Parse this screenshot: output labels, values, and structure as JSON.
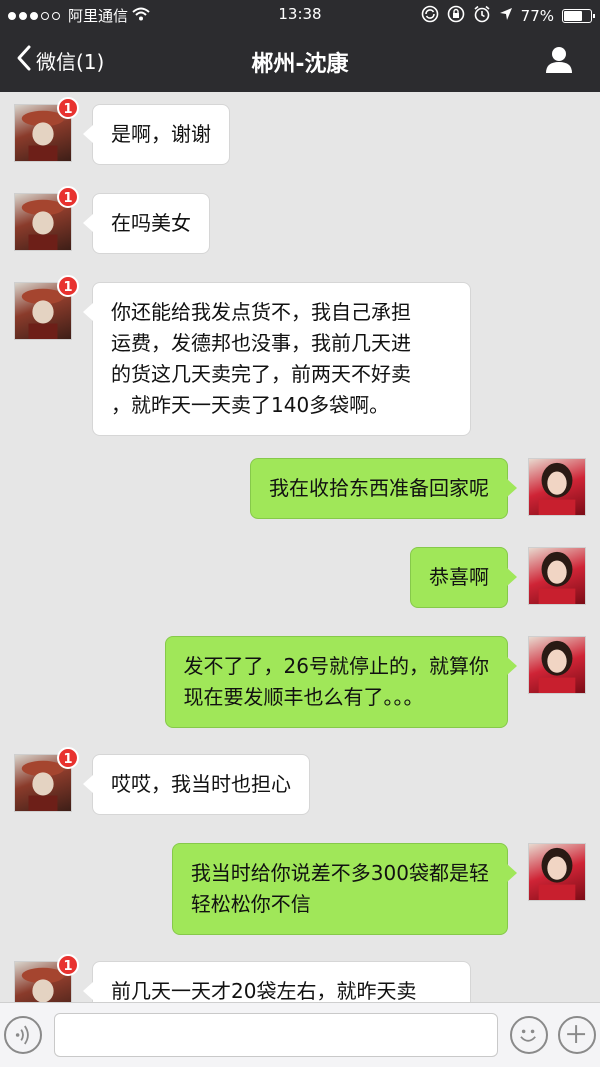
{
  "status_bar": {
    "carrier": "阿里通信",
    "time": "13:38",
    "battery": "77%",
    "battery_level": 0.77,
    "icons": [
      "signal-dots",
      "wifi-icon",
      "sync-icon",
      "orientation-lock-icon",
      "alarm-icon",
      "location-icon",
      "battery-icon"
    ]
  },
  "nav": {
    "back_label": "微信(1)",
    "title": "郴州-沈康",
    "icons": [
      "chevron-left-icon",
      "profile-icon"
    ]
  },
  "messages": [
    {
      "side": "left",
      "badge": "1",
      "lines": [
        "是啊，谢谢"
      ]
    },
    {
      "side": "left",
      "badge": "1",
      "lines": [
        "在吗美女"
      ]
    },
    {
      "side": "left",
      "badge": "1",
      "lines": [
        "你还能给我发点货不，我自己承担",
        "运费，发德邦也没事，我前几天进",
        "的货这几天卖完了，前两天不好卖",
        "，就昨天一天卖了140多袋啊。"
      ]
    },
    {
      "side": "right",
      "lines": [
        "我在收拾东西准备回家呢"
      ]
    },
    {
      "side": "right",
      "lines": [
        "恭喜啊"
      ]
    },
    {
      "side": "right",
      "lines": [
        "发不了了，26号就停止的，就算你",
        "现在要发顺丰也么有了。。。"
      ]
    },
    {
      "side": "left",
      "badge": "1",
      "lines": [
        "哎哎，我当时也担心"
      ]
    },
    {
      "side": "right",
      "lines": [
        "我当时给你说差不多300袋都是轻",
        "轻松松你不信"
      ]
    },
    {
      "side": "left",
      "badge": "1",
      "lines": [
        "前几天一天才20袋左右，就昨天卖"
      ]
    }
  ],
  "input_bar": {
    "icons": [
      "voice-icon",
      "emoji-icon",
      "plus-icon"
    ]
  }
}
